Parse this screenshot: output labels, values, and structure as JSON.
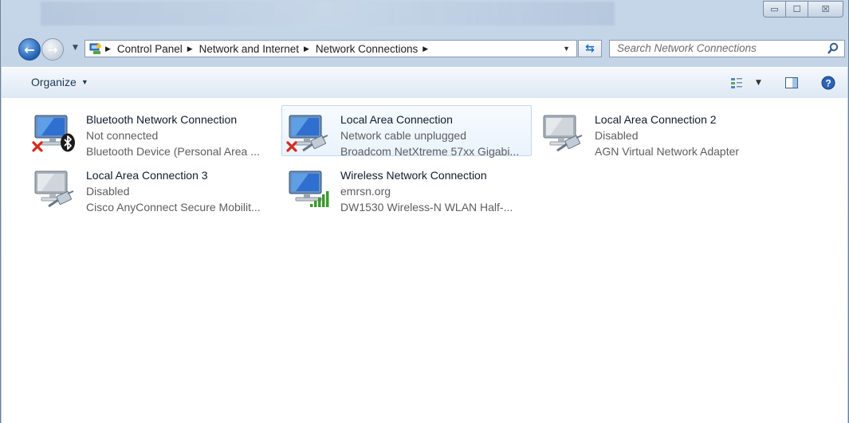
{
  "window": {
    "controls": {
      "minimize": "▭",
      "maximize": "☐",
      "close": "☒"
    }
  },
  "navbar": {
    "breadcrumb": [
      "Control Panel",
      "Network and Internet",
      "Network Connections"
    ],
    "search_placeholder": "Search Network Connections"
  },
  "toolbar": {
    "organize_label": "Organize"
  },
  "connections": [
    {
      "name": "Bluetooth Network Connection",
      "status": "Not connected",
      "device": "Bluetooth Device (Personal Area ...",
      "badge": "red-x",
      "adapter_icon": "bluetooth-icon",
      "selected": false
    },
    {
      "name": "Local Area Connection",
      "status": "Network cable unplugged",
      "device": "Broadcom NetXtreme 57xx Gigabi...",
      "badge": "red-x",
      "adapter_icon": "ethernet-cable-icon",
      "selected": true
    },
    {
      "name": "Local Area Connection 2",
      "status": "Disabled",
      "device": "AGN Virtual Network Adapter",
      "badge": "none",
      "adapter_icon": "ethernet-cable-icon",
      "selected": false
    },
    {
      "name": "Local Area Connection 3",
      "status": "Disabled",
      "device": "Cisco AnyConnect Secure Mobilit...",
      "badge": "none",
      "adapter_icon": "ethernet-cable-icon",
      "selected": false
    },
    {
      "name": "Wireless Network Connection",
      "status": "emrsn.org",
      "device": "DW1530 Wireless-N WLAN Half-...",
      "badge": "none",
      "adapter_icon": "signal-bars-icon",
      "selected": false
    }
  ],
  "colors": {
    "accent_blue": "#1f5fb4",
    "error_red": "#d42a1c",
    "signal_green": "#3c9a2e",
    "selection_border": "#c5d9ee"
  }
}
